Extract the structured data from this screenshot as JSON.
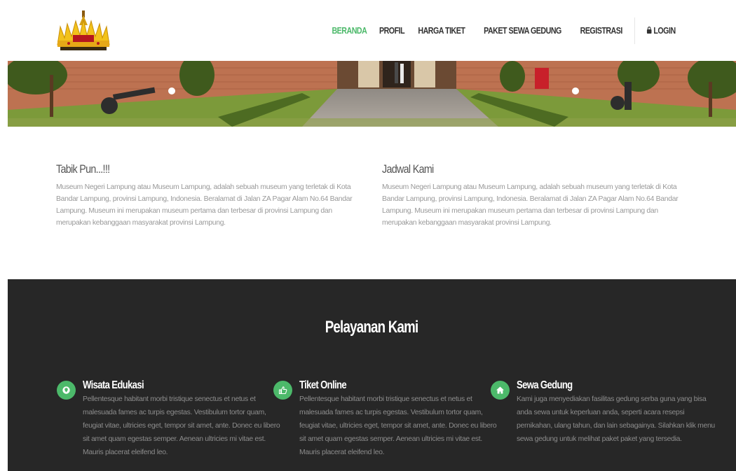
{
  "header": {
    "logo_name": "siger-crown-logo",
    "nav": [
      {
        "label": "BERANDA",
        "active": true
      },
      {
        "label": "PROFIL",
        "active": false
      },
      {
        "label": "HARGA TIKET",
        "active": false
      },
      {
        "label": "PAKET SEWA GEDUNG",
        "active": false
      },
      {
        "label": "REGISTRASI",
        "active": false
      }
    ],
    "login_label": "LOGIN",
    "login_icon": "lock-icon"
  },
  "intro": {
    "left": {
      "title": "Tabik Pun...!!!",
      "text": "Museum Negeri Lampung atau Museum Lampung, adalah sebuah museum yang terletak di Kota Bandar Lampung, provinsi Lampung, Indonesia. Beralamat di Jalan ZA Pagar Alam No.64 Bandar Lampung. Museum ini merupakan museum pertama dan terbesar di provinsi Lampung dan merupakan kebanggaan masyarakat provinsi Lampung."
    },
    "right": {
      "title": "Jadwal Kami",
      "text": "Museum Negeri Lampung atau Museum Lampung, adalah sebuah museum yang terletak di Kota Bandar Lampung, provinsi Lampung, Indonesia. Beralamat di Jalan ZA Pagar Alam No.64 Bandar Lampung. Museum ini merupakan museum pertama dan terbesar di provinsi Lampung dan merupakan kebanggaan masyarakat provinsi Lampung."
    }
  },
  "services": {
    "title": "Pelayanan Kami",
    "items": [
      {
        "icon": "location-pin-icon",
        "title": "Wisata Edukasi",
        "text": "Pellentesque habitant morbi tristique senectus et netus et malesuada fames ac turpis egestas. Vestibulum tortor quam, feugiat vitae, ultricies eget, tempor sit amet, ante. Donec eu libero sit amet quam egestas semper. Aenean ultricies mi vitae est. Mauris placerat eleifend leo."
      },
      {
        "icon": "thumbs-up-icon",
        "title": "Tiket Online",
        "text": "Pellentesque habitant morbi tristique senectus et netus et malesuada fames ac turpis egestas. Vestibulum tortor quam, feugiat vitae, ultricies eget, tempor sit amet, ante. Donec eu libero sit amet quam egestas semper. Aenean ultricies mi vitae est. Mauris placerat eleifend leo."
      },
      {
        "icon": "home-icon",
        "title": "Sewa Gedung",
        "text": "Kami juga menyediakan fasilitas gedung serba guna yang bisa anda sewa untuk keperluan anda, seperti acara resepsi pernikahan, ulang tahun, dan lain sebagainya. Silahkan klik menu sewa gedung untuk melihat paket paket yang tersedia."
      }
    ]
  },
  "colors": {
    "accent": "#4cb96a",
    "dark_section": "#272727",
    "body_text": "#999999"
  }
}
